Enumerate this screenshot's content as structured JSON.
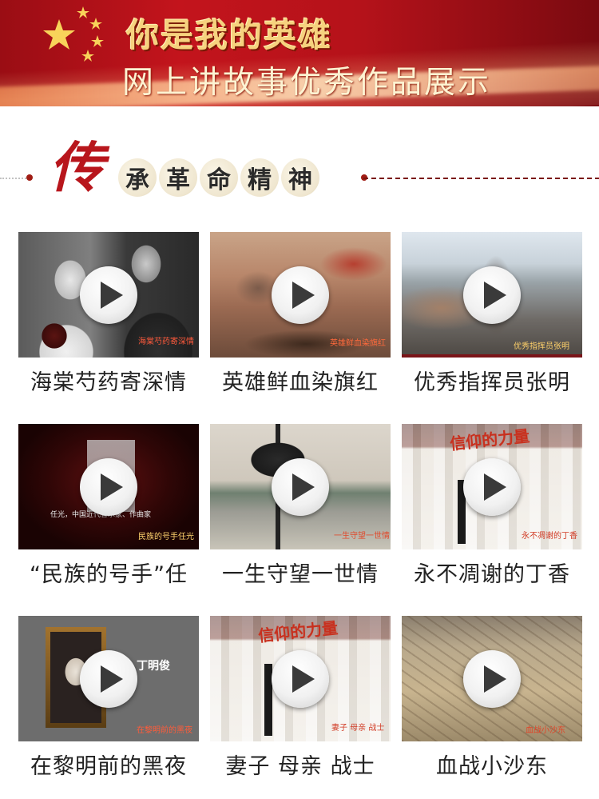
{
  "banner": {
    "title": "你是我的英雄",
    "subtitle": "网上讲故事优秀作品展示"
  },
  "section": {
    "big_char": "传",
    "chars": [
      "承",
      "革",
      "命",
      "精",
      "神"
    ]
  },
  "videos": [
    {
      "title": "海棠芍药寄深情",
      "overlay": "海棠芍药寄深情"
    },
    {
      "title": "英雄鲜血染旗红",
      "overlay": "英雄鲜血染旗红"
    },
    {
      "title": "优秀指挥员张明",
      "overlay": "优秀指挥员张明"
    },
    {
      "title": "“民族的号手”任",
      "overlay": "民族的号手任光",
      "overlay2": "任光，中国近代音乐家、作曲家"
    },
    {
      "title": "一生守望一世情",
      "overlay": "一生守望一世情"
    },
    {
      "title": "永不凋谢的丁香",
      "overlay": "永不凋谢的丁香",
      "sign": "信仰的力量"
    },
    {
      "title": "在黎明前的黑夜",
      "overlay": "在黎明前的黑夜",
      "name_tag": "丁明俊"
    },
    {
      "title": "妻子 母亲 战士",
      "overlay": "妻子 母亲 战士",
      "sign": "信仰的力量"
    },
    {
      "title": "血战小沙东",
      "overlay": "血战小沙东"
    }
  ],
  "colors": {
    "accent": "#b8161c",
    "banner": "#c3141c",
    "gold": "#f6d27e"
  },
  "icons": {
    "play": "play-icon"
  }
}
